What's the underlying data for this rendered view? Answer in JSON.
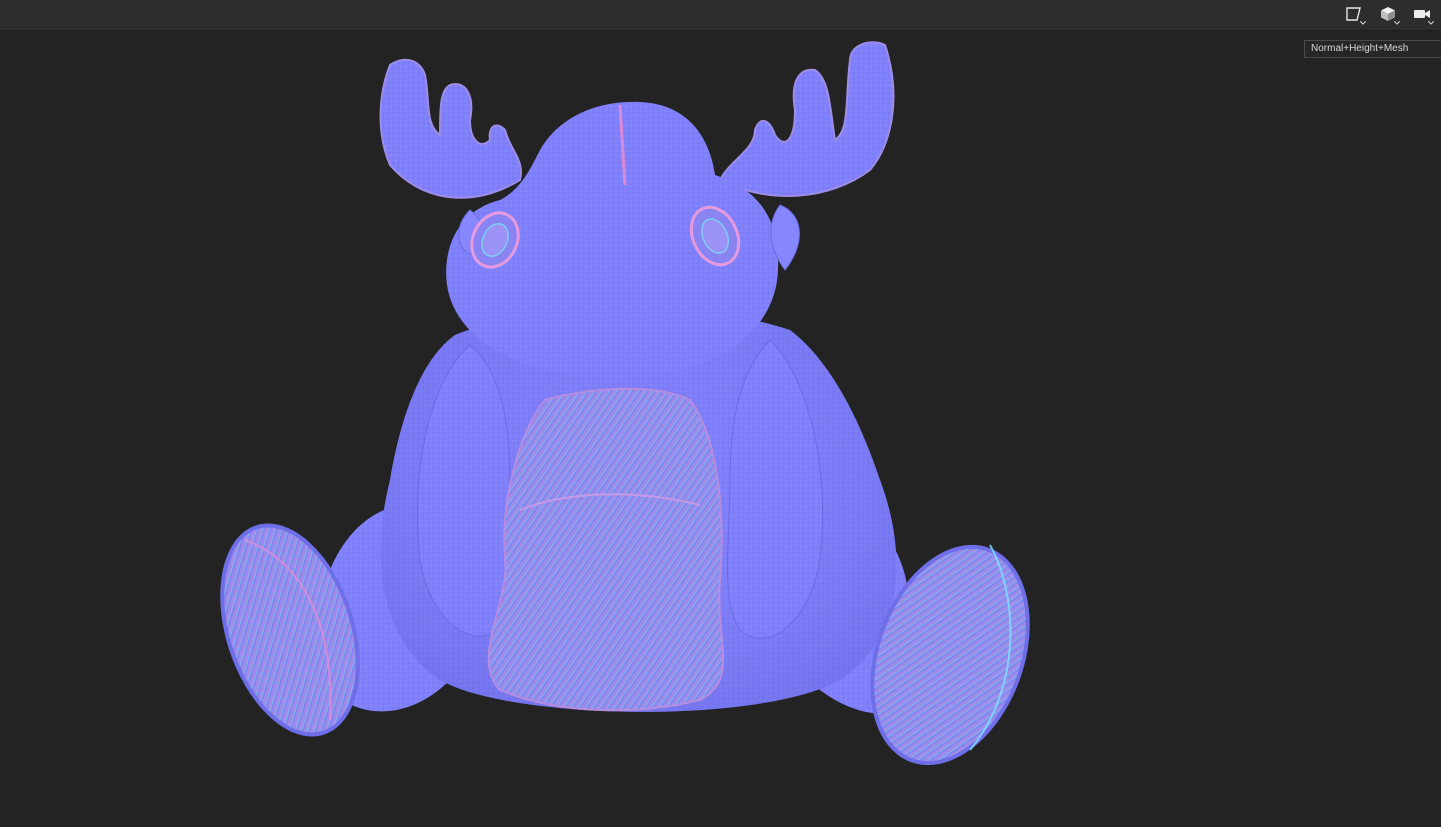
{
  "viewport": {
    "channel_label": "Normal+Height+Mesh"
  },
  "toolbar": {
    "icons": [
      "camera-frame-icon",
      "cube-view-icon",
      "video-camera-icon"
    ]
  },
  "colors": {
    "background": "#232323",
    "toolbar": "#2d2d2d",
    "normal_base": "#7f7fff",
    "normal_highlight_pink": "#e28ad8",
    "normal_highlight_cyan": "#7ee0ff"
  }
}
